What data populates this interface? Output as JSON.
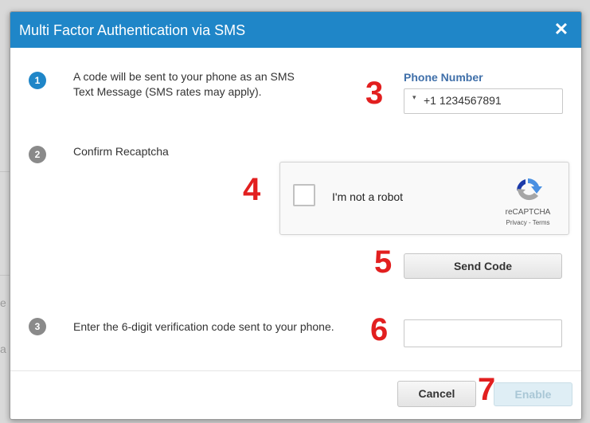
{
  "dialog": {
    "title": "Multi Factor Authentication via SMS",
    "close_glyph": "✕"
  },
  "steps": [
    {
      "number": "1",
      "text": "A code will be sent to your phone as an SMS Text Message (SMS rates may apply).",
      "state": "active"
    },
    {
      "number": "2",
      "text": "Confirm Recaptcha",
      "state": "inactive"
    },
    {
      "number": "3",
      "text": "Enter the 6-digit verification code sent to your phone.",
      "state": "inactive"
    }
  ],
  "phone": {
    "label": "Phone Number",
    "caret_glyph": "▾",
    "value": "+1 1234567891"
  },
  "recaptcha": {
    "checkbox_label": "I'm not a robot",
    "brand": "reCAPTCHA",
    "links": "Privacy - Terms"
  },
  "buttons": {
    "send_code": "Send Code",
    "cancel": "Cancel",
    "enable": "Enable"
  },
  "code_input": {
    "value": ""
  },
  "annotations": [
    "3",
    "4",
    "5",
    "6",
    "7"
  ],
  "colors": {
    "titlebar": "#1f86c8",
    "annotation": "#e21f1f",
    "phone_label": "#3f6fa9",
    "step_active": "#1f86c8",
    "step_inactive": "#8a8a8a"
  },
  "icons": {
    "close": "close-icon",
    "recaptcha": "recaptcha-logo-icon",
    "dropdown": "chevron-down-icon"
  }
}
